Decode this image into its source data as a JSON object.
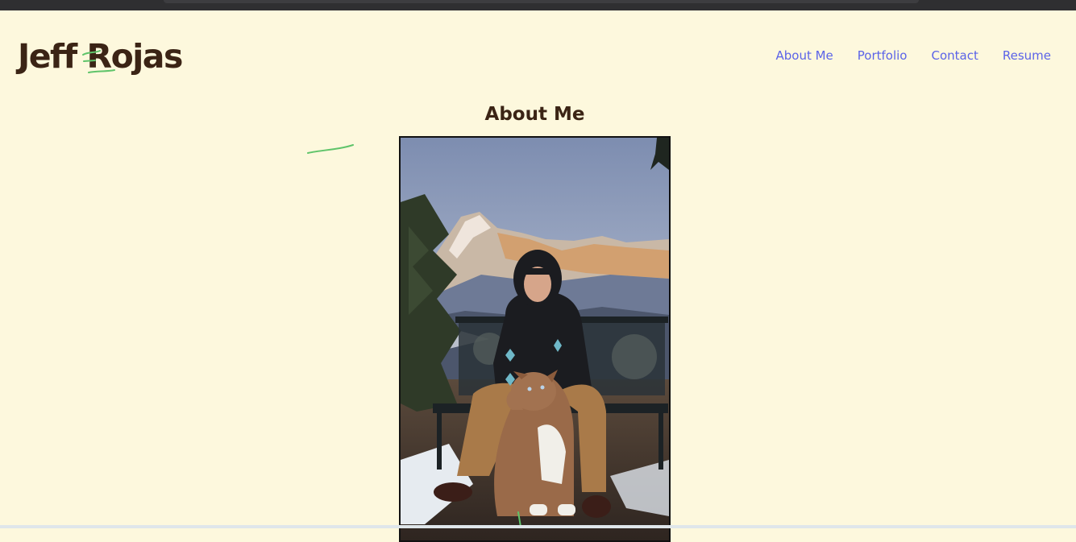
{
  "site": {
    "title": "Jeff Rojas"
  },
  "nav": {
    "items": [
      {
        "label": "About Me"
      },
      {
        "label": "Portfolio"
      },
      {
        "label": "Contact"
      },
      {
        "label": "Resume"
      }
    ]
  },
  "main": {
    "heading": "About Me",
    "photo_alt": "Jeff Rojas sitting on a bench with his dog in front of snowy mountains"
  },
  "colors": {
    "background": "#fdf8dd",
    "title": "#3b2415",
    "nav_link": "#5b63e8",
    "annotation_scribble": "#5fc46a"
  }
}
